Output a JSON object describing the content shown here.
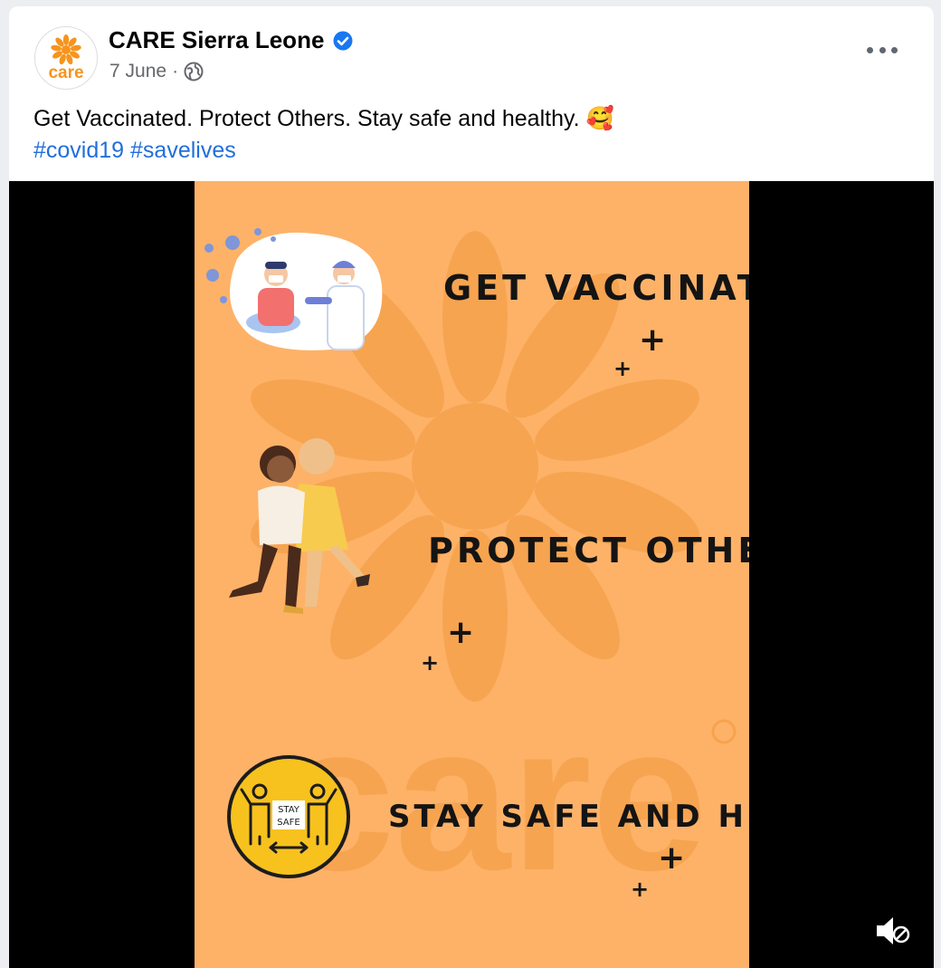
{
  "post": {
    "page_name": "CARE Sierra Leone",
    "date": "7 June",
    "separator": "·",
    "avatar_text": "care",
    "caption": "Get Vaccinated. Protect Others. Stay safe and healthy.",
    "caption_emoji": "🥰",
    "hashtags": [
      "#covid19",
      "#savelives"
    ]
  },
  "video": {
    "headlines": [
      "GET VACCINATED",
      "PROTECT OTHERS",
      "STAY SAFE AND HEALTHY"
    ],
    "watermark_text": "care",
    "badge_line1": "STAY",
    "badge_line2": "SAFE"
  },
  "colors": {
    "poster_bg": "#fdb268",
    "brand_orange": "#f7941d",
    "link_blue": "#216fdb",
    "verified_blue": "#1877f2",
    "badge_yellow": "#f7c21e"
  },
  "icons": {
    "verified": "verified-badge-icon",
    "privacy": "globe-icon",
    "more": "more-options-icon",
    "mute": "muted-speaker-icon"
  }
}
